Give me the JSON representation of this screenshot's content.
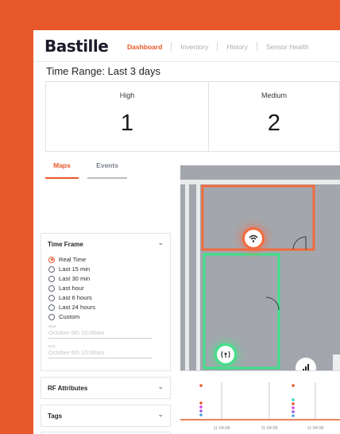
{
  "header": {
    "logo": "Bastille",
    "nav": [
      {
        "label": "Dashboard",
        "active": true
      },
      {
        "label": "Inventory",
        "active": false
      },
      {
        "label": "History",
        "active": false
      },
      {
        "label": "Sensor Health",
        "active": false
      }
    ]
  },
  "page_title": "Time Range: Last 3 days",
  "summary": [
    {
      "label": "High",
      "value": "1"
    },
    {
      "label": "Medium",
      "value": "2"
    }
  ],
  "tabs": [
    {
      "label": "Maps",
      "active": true
    },
    {
      "label": "Events",
      "active": false
    }
  ],
  "time_frame": {
    "title": "Time Frame",
    "options": [
      "Real Time",
      "Last 15 min",
      "Last 30 min",
      "Last hour",
      "Last 6 hours",
      "Last 24 hours",
      "Custom"
    ],
    "selected": "Real Time",
    "start_label": "Start",
    "start_value": "October 6th 10:06am",
    "end_label": "End",
    "end_value": "October 6th 10:06am"
  },
  "rf_attributes": {
    "title": "RF Attributes"
  },
  "tags": {
    "title": "Tags"
  },
  "map": {
    "devices": [
      {
        "icon": "wifi-icon",
        "level": "high"
      },
      {
        "icon": "cellular-icon",
        "level": "low"
      },
      {
        "icon": "bar-chart-icon",
        "level": "neutral"
      }
    ]
  },
  "timeline": {
    "ticks": [
      "11:04:08",
      "11:04:08",
      "11:04:08"
    ]
  },
  "colors": {
    "accent": "#e8582a",
    "alert_high": "#f0643a",
    "alert_low": "#37e07a",
    "map_bg": "#a3a7ad"
  }
}
